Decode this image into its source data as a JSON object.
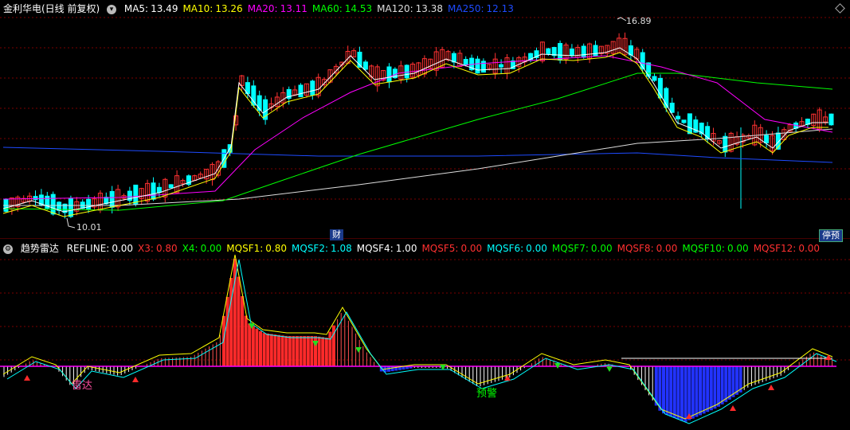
{
  "stock": {
    "title": "金利华电(日线 前复权)"
  },
  "ma": [
    {
      "label": "MA5:",
      "value": "13.49",
      "color": "#ffffff"
    },
    {
      "label": "MA10:",
      "value": "13.26",
      "color": "#ffff00"
    },
    {
      "label": "MA20:",
      "value": "13.11",
      "color": "#ff00ff"
    },
    {
      "label": "MA60:",
      "value": "14.53",
      "color": "#00ff00"
    },
    {
      "label": "MA120:",
      "value": "13.38",
      "color": "#dddddd"
    },
    {
      "label": "MA250:",
      "value": "12.13",
      "color": "#1e4bff"
    }
  ],
  "price_annotations": {
    "high": "16.89",
    "low": "10.01"
  },
  "badges": {
    "cai": "财",
    "suspend": "停预"
  },
  "indicator": {
    "title": "趋势雷达",
    "params": [
      {
        "label": "REFLINE:",
        "value": "0.00",
        "color": "#ffffff"
      },
      {
        "label": "X3:",
        "value": "0.80",
        "color": "#ff3030"
      },
      {
        "label": "X4:",
        "value": "0.00",
        "color": "#00ff00"
      },
      {
        "label": "MQSF1:",
        "value": "0.80",
        "color": "#ffff00"
      },
      {
        "label": "MQSF2:",
        "value": "1.08",
        "color": "#00ffff"
      },
      {
        "label": "MQSF4:",
        "value": "1.00",
        "color": "#ffffff"
      },
      {
        "label": "MQSF5:",
        "value": "0.00",
        "color": "#ff3030"
      },
      {
        "label": "MQSF6:",
        "value": "0.00",
        "color": "#00ffff"
      },
      {
        "label": "MQSF7:",
        "value": "0.00",
        "color": "#00ff00"
      },
      {
        "label": "MQSF8:",
        "value": "0.00",
        "color": "#ff3030"
      },
      {
        "label": "MQSF10:",
        "value": "0.00",
        "color": "#00ff00"
      },
      {
        "label": "MQSF12:",
        "value": "0.00",
        "color": "#ff3030"
      }
    ],
    "signals": {
      "radar": "雷达",
      "warning": "预警"
    }
  },
  "colors": {
    "up": "#ff3232",
    "down": "#00ffff",
    "grid": "#7a0000",
    "ma250": "#1e4bff"
  }
}
